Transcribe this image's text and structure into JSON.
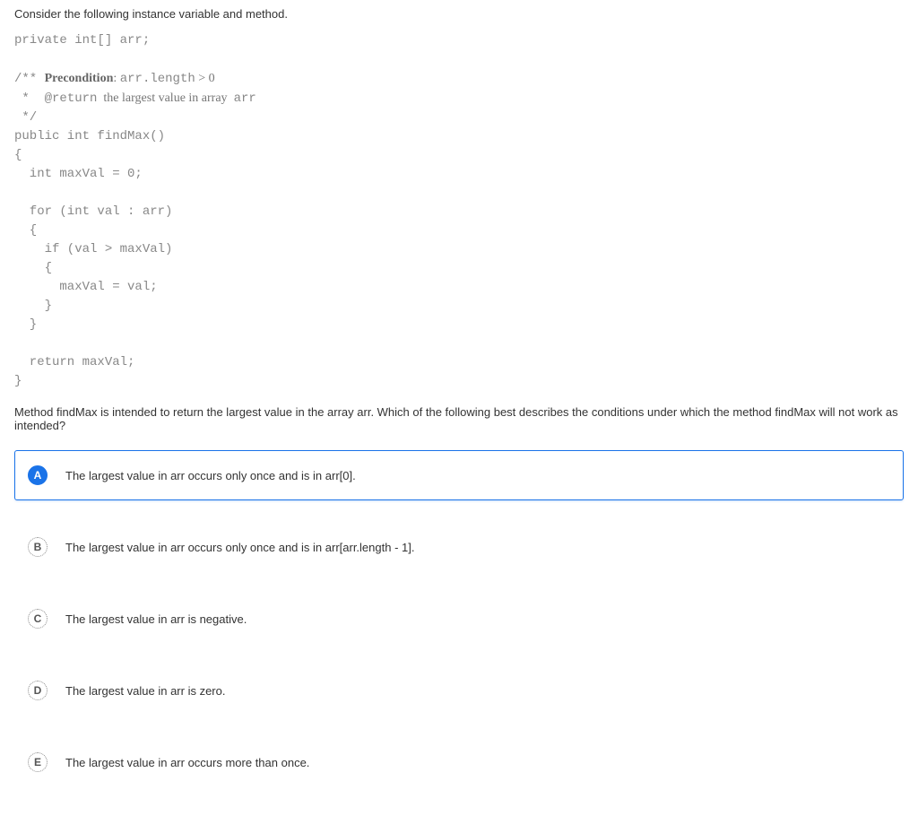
{
  "intro": "Consider the following instance variable and method.",
  "code": {
    "line1": "private int[] arr;",
    "line2": "",
    "line3_prefix": "/** ",
    "line3_bold": "Precondition",
    "line3_after": ": ",
    "line3_mono": "arr.length",
    "line3_tail_nonmono": " > 0",
    "line4_prefix": " *  ",
    "line4_mono": "@return",
    "line4_nonmono": "  the largest value in array  ",
    "line4_mono2": "arr",
    "line5": " */",
    "line6": "public int findMax()",
    "line7": "{",
    "line8": "  int maxVal = 0;",
    "line9": "",
    "line10": "  for (int val : arr)",
    "line11": "  {",
    "line12": "    if (val > maxVal)",
    "line13": "    {",
    "line14": "      maxVal = val;",
    "line15": "    }",
    "line16": "  }",
    "line17": "",
    "line18": "  return maxVal;",
    "line19": "}"
  },
  "question": "Method findMax is intended to return the largest value in the array arr. Which of the following best describes the conditions under which the method findMax will not work as intended?",
  "options": {
    "a": {
      "letter": "A",
      "text": "The largest value in arr occurs only once and is in arr[0].",
      "selected": true
    },
    "b": {
      "letter": "B",
      "text": "The largest value in arr occurs only once and is in arr[arr.length - 1].",
      "selected": false
    },
    "c": {
      "letter": "C",
      "text": "The largest value in arr is negative.",
      "selected": false
    },
    "d": {
      "letter": "D",
      "text": "The largest value in arr is zero.",
      "selected": false
    },
    "e": {
      "letter": "E",
      "text": "The largest value in arr occurs more than once.",
      "selected": false
    }
  }
}
